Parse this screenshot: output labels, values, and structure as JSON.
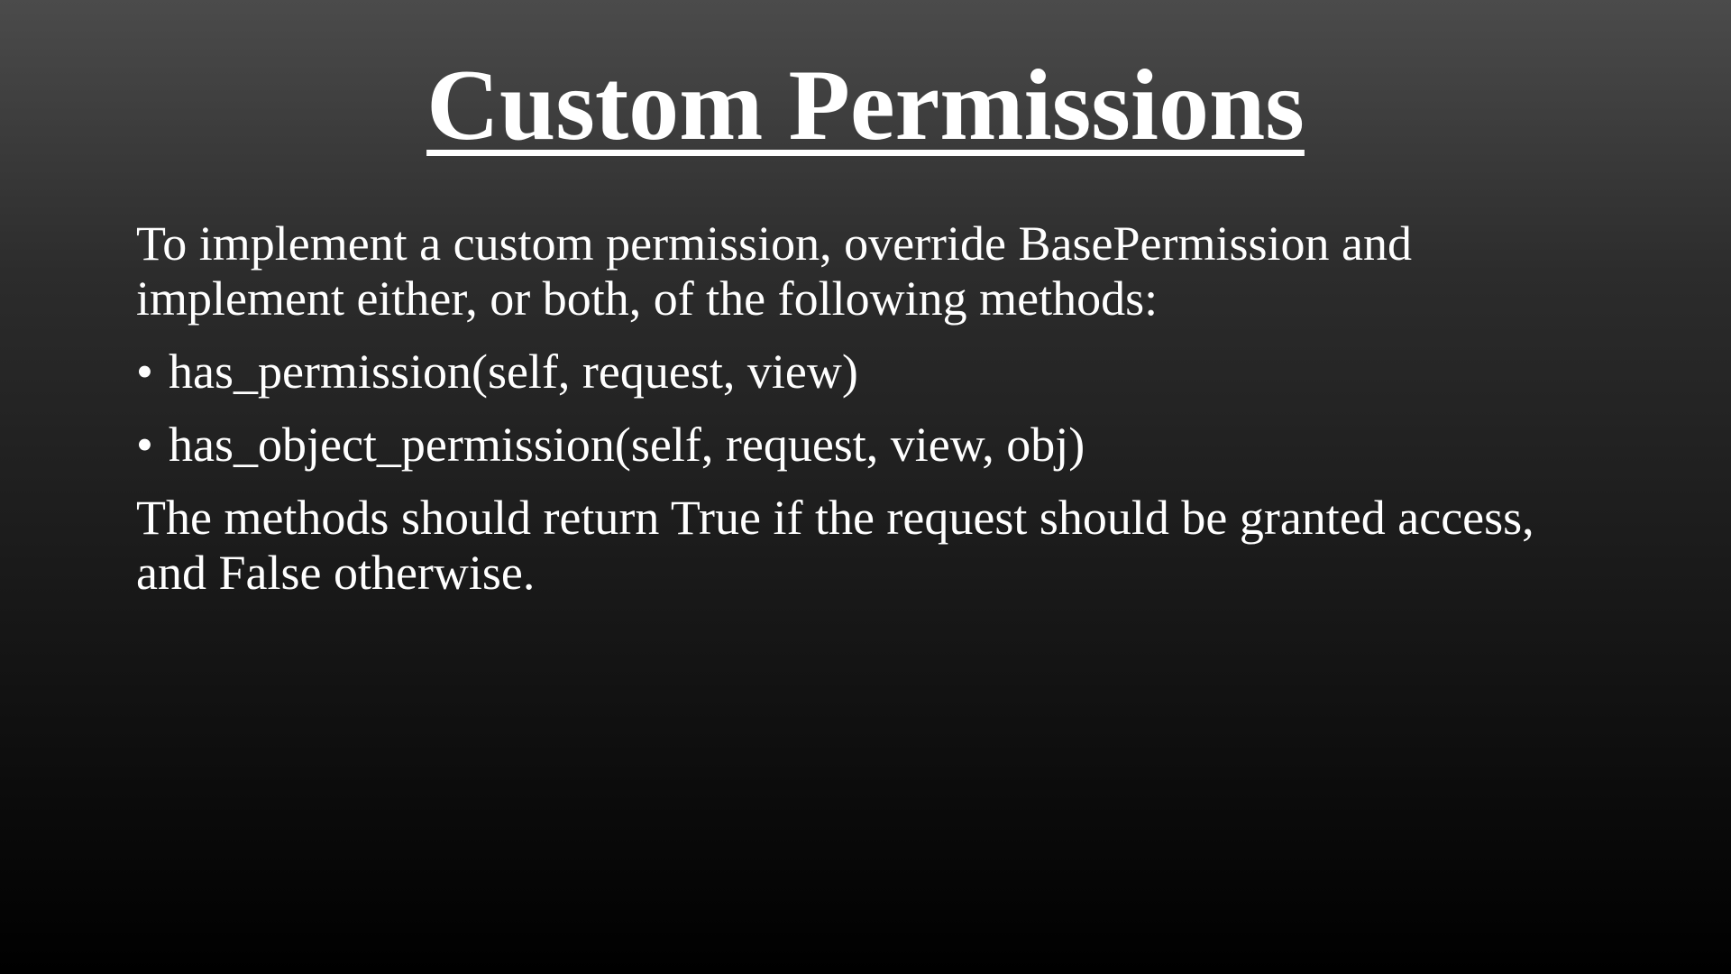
{
  "slide": {
    "title": "Custom Permissions",
    "intro": "To implement a custom permission, override BasePermission and implement either, or both, of the following methods:",
    "bullets": [
      "has_permission(self, request, view)",
      "has_object_permission(self, request, view, obj)"
    ],
    "bullet_glyph": "•",
    "conclusion": "The methods should return True if the request should be granted access, and False otherwise."
  },
  "colors": {
    "text": "#ffffff",
    "background_top": "#4b4b4b",
    "background_bottom": "#000000"
  }
}
